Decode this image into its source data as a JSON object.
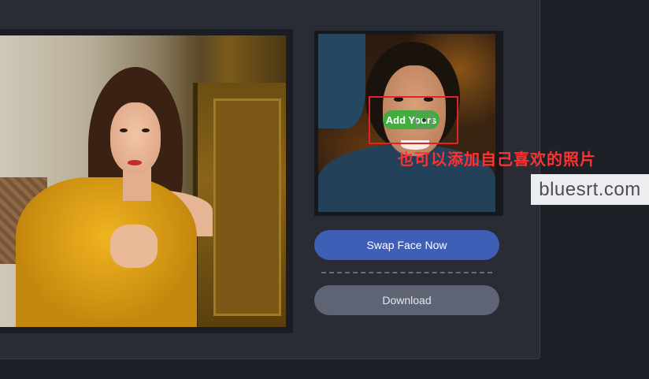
{
  "upload": {
    "add_label": "Add Yours"
  },
  "annotation": {
    "text": "也可以添加自己喜欢的照片"
  },
  "watermark": {
    "text": "bluesrt.com"
  },
  "actions": {
    "swap_label": "Swap Face Now",
    "download_label": "Download"
  },
  "colors": {
    "background": "#1e2027",
    "panel": "#292c35",
    "add_button": "#3fae3f",
    "swap_button": "#3f5eb5",
    "download_button": "#5f6474",
    "annotation": "#ff3232"
  }
}
